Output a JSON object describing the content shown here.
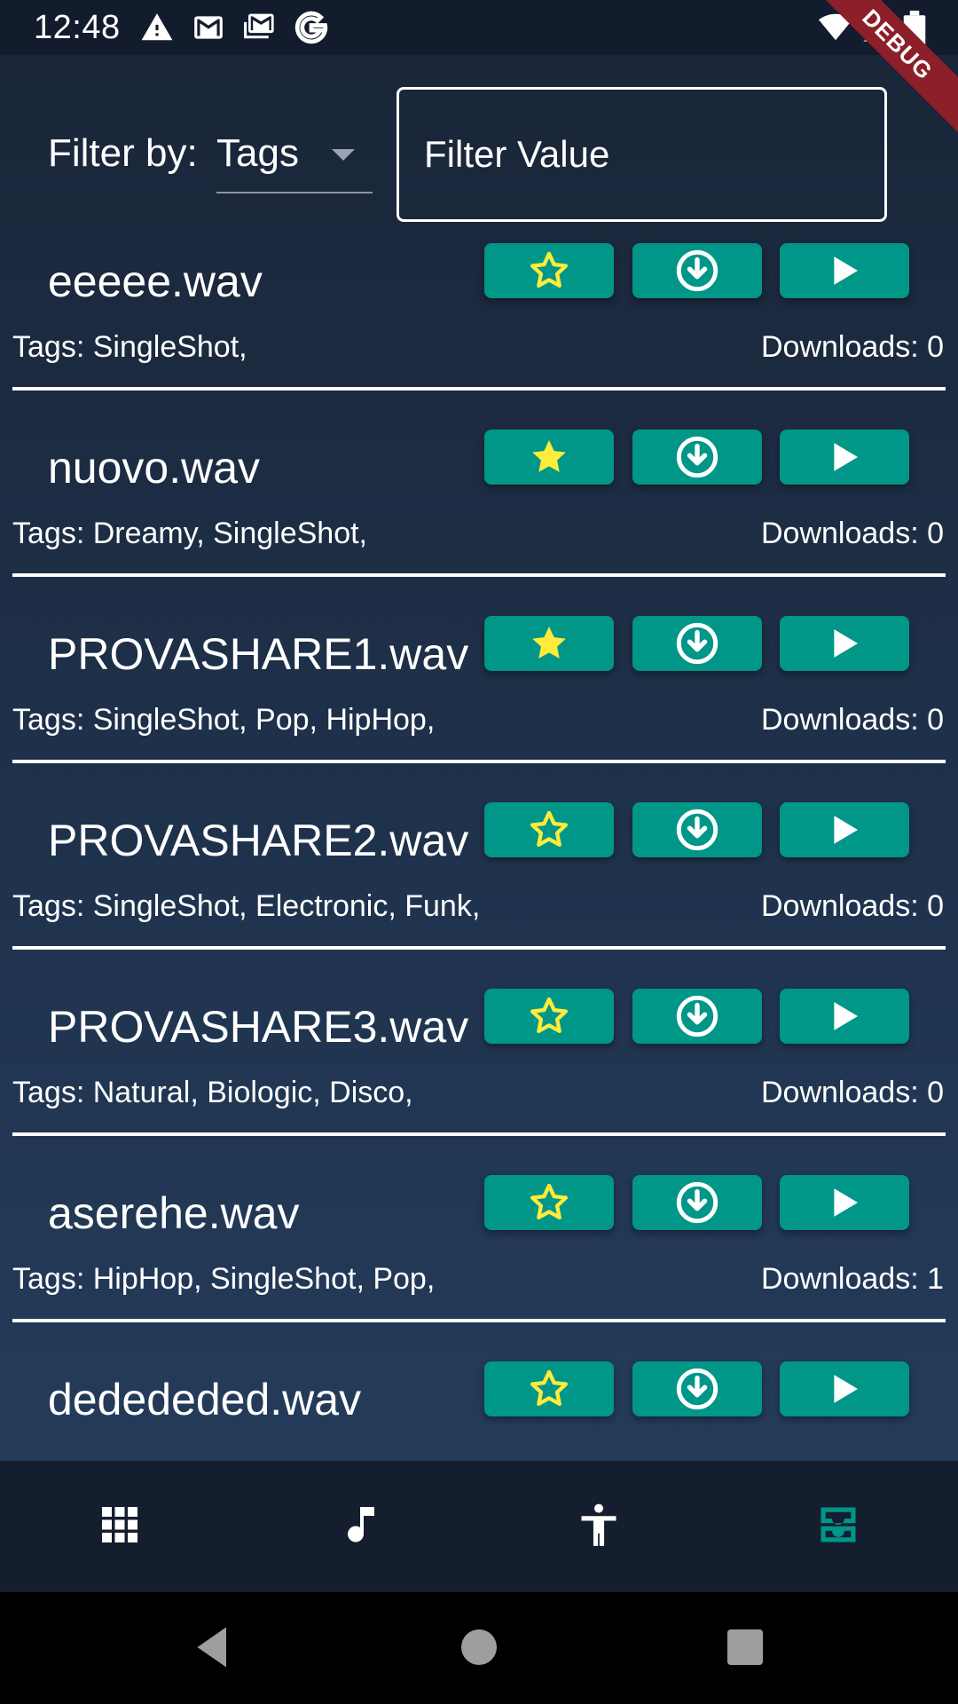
{
  "status_bar": {
    "time": "12:48",
    "left_icons": [
      "warning-icon",
      "gmail-icon",
      "gmail-stack-icon",
      "google-icon"
    ],
    "right_icons": [
      "wifi-icon",
      "signal-icon",
      "battery-icon"
    ],
    "debug_label": "DEBUG"
  },
  "filter": {
    "label": "Filter by:",
    "selected": "Tags",
    "input_placeholder": "Filter Value"
  },
  "items": [
    {
      "name": "eeeee.wav",
      "favorite": false,
      "tags": "Tags: SingleShot,",
      "downloads": "Downloads: 0"
    },
    {
      "name": "nuovo.wav",
      "favorite": true,
      "tags": "Tags: Dreamy, SingleShot,",
      "downloads": "Downloads: 0"
    },
    {
      "name": "PROVASHARE1.wav",
      "favorite": true,
      "tags": "Tags: SingleShot, Pop, HipHop,",
      "downloads": "Downloads: 0"
    },
    {
      "name": "PROVASHARE2.wav",
      "favorite": false,
      "tags": "Tags: SingleShot, Electronic, Funk,",
      "downloads": "Downloads: 0"
    },
    {
      "name": "PROVASHARE3.wav",
      "favorite": false,
      "tags": "Tags: Natural, Biologic, Disco,",
      "downloads": "Downloads: 0"
    },
    {
      "name": "aserehe.wav",
      "favorite": false,
      "tags": "Tags: HipHop, SingleShot, Pop,",
      "downloads": "Downloads: 1"
    },
    {
      "name": "dedededed.wav",
      "favorite": false,
      "tags": "",
      "downloads": ""
    }
  ],
  "bottom_nav": [
    {
      "icon": "grid-icon",
      "active": false
    },
    {
      "icon": "music-note-icon",
      "active": false
    },
    {
      "icon": "accessibility-icon",
      "active": false
    },
    {
      "icon": "inbox-icon",
      "active": true
    }
  ],
  "colors": {
    "accent": "#009688",
    "star": "#ffeb3b",
    "debug": "#8d1f2a"
  }
}
